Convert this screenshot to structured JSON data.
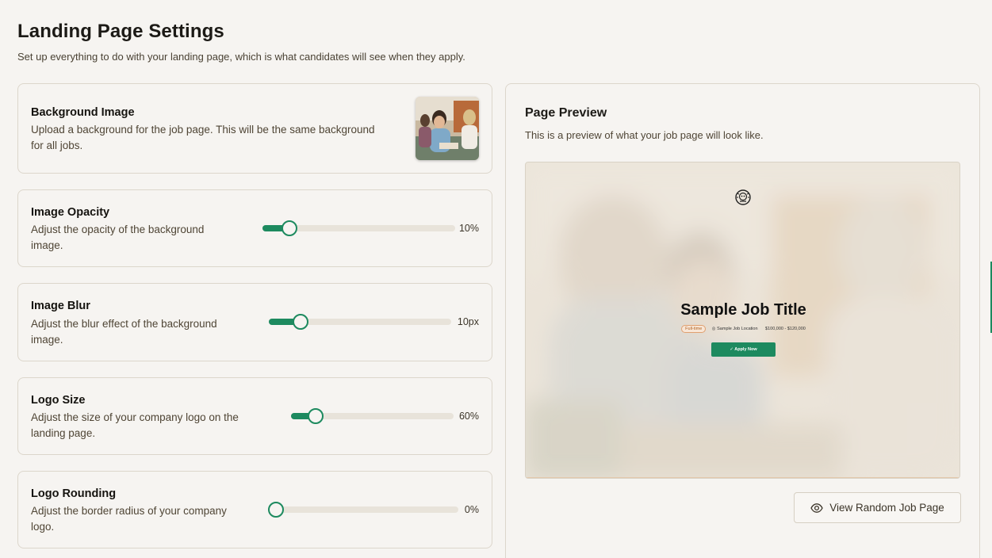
{
  "page": {
    "title": "Landing Page Settings",
    "subtitle": "Set up everything to do with your landing page, which is what candidates will see when they apply."
  },
  "background_image": {
    "title": "Background Image",
    "description_line1": "Upload a background for the job page. This will be the same background",
    "description_line2": "for all jobs."
  },
  "settings": [
    {
      "title": "Image Opacity",
      "desc1": "Adjust the opacity of the background",
      "desc2": "image.",
      "value": "10%",
      "level": 0.1
    },
    {
      "title": "Image Blur",
      "desc1": "Adjust the blur effect of the background",
      "desc2": "image.",
      "value": "10px",
      "level": 0.13
    },
    {
      "title": "Logo Size",
      "desc1": "Adjust the size of your company logo on the",
      "desc2": "landing page.",
      "value": "60%",
      "level": 0.1
    },
    {
      "title": "Logo Rounding",
      "desc1": "Adjust the border radius of your company",
      "desc2": "logo.",
      "value": "0%",
      "level": 0.0
    }
  ],
  "preview": {
    "title": "Page Preview",
    "description": "This is a preview of what your job page will look like.",
    "job_title": "Sample Job Title",
    "badge": "Full-time",
    "location": "Sample Job Location",
    "salary": "$100,000 - $120,000",
    "apply_label": "✓ Apply Now",
    "view_button": "View Random Job Page"
  },
  "colors": {
    "accent": "#1d8a5f",
    "background": "#f6f4f1",
    "border": "#dcd6cb"
  }
}
